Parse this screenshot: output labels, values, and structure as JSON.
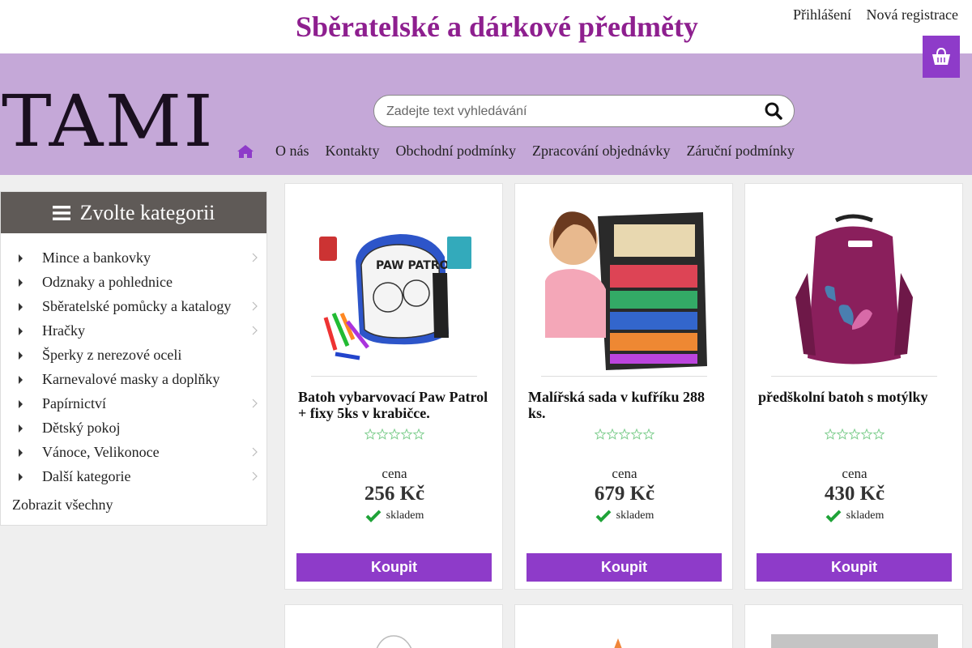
{
  "header": {
    "site_title": "Sběratelské a dárkové předměty",
    "login": "Přihlášení",
    "register": "Nová registrace",
    "logo_text": "TAMI",
    "search_placeholder": "Zadejte text vyhledávání",
    "nav": [
      "O nás",
      "Kontakty",
      "Obchodní podmínky",
      "Zpracování objednávky",
      "Záruční podmínky"
    ]
  },
  "sidebar": {
    "heading": "Zvolte kategorii",
    "items": [
      {
        "label": "Mince a bankovky",
        "has_sub": true
      },
      {
        "label": "Odznaky a pohlednice",
        "has_sub": false
      },
      {
        "label": "Sběratelské pomůcky a katalogy",
        "has_sub": true
      },
      {
        "label": "Hračky",
        "has_sub": true
      },
      {
        "label": "Šperky z nerezové oceli",
        "has_sub": false
      },
      {
        "label": "Karnevalové masky a doplňky",
        "has_sub": false
      },
      {
        "label": "Papírnictví",
        "has_sub": true
      },
      {
        "label": "Dětský pokoj",
        "has_sub": false
      },
      {
        "label": "Vánoce, Velikonoce",
        "has_sub": true
      },
      {
        "label": "Další kategorie",
        "has_sub": true
      }
    ],
    "show_all": "Zobrazit všechny"
  },
  "products": [
    {
      "title": "Batoh vybarvovací Paw Patrol + fixy 5ks v krabičce.",
      "price_label": "cena",
      "price": "256 Kč",
      "stock": "skladem",
      "buy": "Koupit"
    },
    {
      "title": "Malířská sada v kufříku 288 ks.",
      "price_label": "cena",
      "price": "679 Kč",
      "stock": "skladem",
      "buy": "Koupit"
    },
    {
      "title": "předškolní batoh s motýlky",
      "price_label": "cena",
      "price": "430 Kč",
      "stock": "skladem",
      "buy": "Koupit"
    }
  ],
  "colors": {
    "accent": "#8e3bc9",
    "title": "#8e1f8f",
    "header_band": "#c5a8d8",
    "stock_check": "#1fa338"
  }
}
